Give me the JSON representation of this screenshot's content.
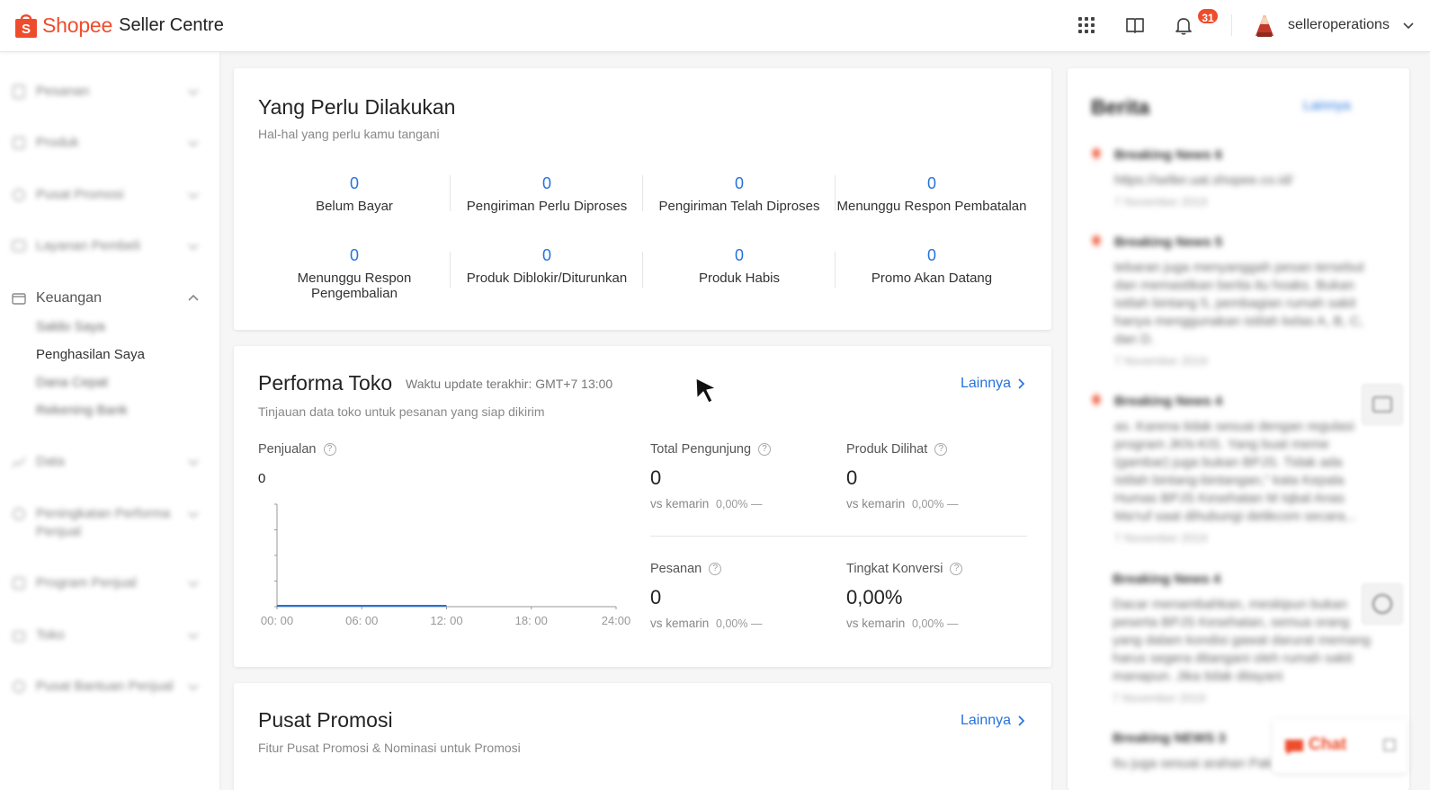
{
  "header": {
    "brand": "Shopee",
    "product": "Seller Centre",
    "notification_count": "31",
    "username": "selleroperations",
    "brand_color": "#ee4d2d",
    "icons": [
      "apps-grid-icon",
      "book-icon",
      "bell-icon",
      "avatar",
      "chevron-down-icon"
    ]
  },
  "sidebar": {
    "items": [
      {
        "label": "Pesanan",
        "icon": "clipboard-icon"
      },
      {
        "label": "Produk",
        "icon": "box-icon"
      },
      {
        "label": "Pusat Promosi",
        "icon": "tag-icon"
      },
      {
        "label": "Layanan Pembeli",
        "icon": "chat-icon"
      },
      {
        "label": "Keuangan",
        "icon": "wallet-icon"
      },
      {
        "label": "Data",
        "icon": "chart-icon"
      },
      {
        "label": "Peningkatan Performa Penjual",
        "icon": "trophy-icon"
      },
      {
        "label": "Program Penjual",
        "icon": "star-icon"
      },
      {
        "label": "Toko",
        "icon": "shop-icon"
      },
      {
        "label": "Pusat Bantuan Penjual",
        "icon": "help-icon"
      }
    ],
    "keuangan_sub": [
      "Saldo Saya",
      "Penghasilan Saya",
      "Dana Cepat",
      "Rekening Bank"
    ]
  },
  "todo": {
    "title": "Yang Perlu Dilakukan",
    "subtitle": "Hal-hal yang perlu kamu tangani",
    "items": [
      {
        "value": "0",
        "label": "Belum Bayar"
      },
      {
        "value": "0",
        "label": "Pengiriman Perlu Diproses"
      },
      {
        "value": "0",
        "label": "Pengiriman Telah Diproses"
      },
      {
        "value": "0",
        "label": "Menunggu Respon Pembatalan"
      },
      {
        "value": "0",
        "label": "Menunggu Respon Pengembalian"
      },
      {
        "value": "0",
        "label": "Produk Diblokir/Diturunkan"
      },
      {
        "value": "0",
        "label": "Produk Habis"
      },
      {
        "value": "0",
        "label": "Promo Akan Datang"
      }
    ]
  },
  "performa": {
    "title": "Performa Toko",
    "update_time": "Waktu update terakhir: GMT+7 13:00",
    "subtitle": "Tinjauan data toko untuk pesanan yang siap dikirim",
    "more": "Lainnya",
    "sales_label": "Penjualan",
    "sales_value": "0",
    "metrics": [
      {
        "label": "Total Pengunjung",
        "value": "0",
        "vs_label": "vs kemarin",
        "vs_value": "0,00% —"
      },
      {
        "label": "Produk Dilihat",
        "value": "0",
        "vs_label": "vs kemarin",
        "vs_value": "0,00% —"
      },
      {
        "label": "Pesanan",
        "value": "0",
        "vs_label": "vs kemarin",
        "vs_value": "0,00% —"
      },
      {
        "label": "Tingkat Konversi",
        "value": "0,00%",
        "vs_label": "vs kemarin",
        "vs_value": "0,00% —"
      }
    ]
  },
  "chart_data": {
    "type": "line",
    "x": [
      "00: 00",
      "06: 00",
      "12: 00",
      "18: 00",
      "24:00"
    ],
    "series": [
      {
        "values": [
          0,
          0,
          0
        ]
      }
    ],
    "title": "",
    "xlabel": "",
    "ylabel": "",
    "line_color": "#2673dd"
  },
  "promosi": {
    "title": "Pusat Promosi",
    "subtitle": "Fitur Pusat Promosi  & Nominasi untuk Promosi",
    "more": "Lainnya"
  },
  "news": {
    "title": "Berita",
    "more": "Lainnya",
    "items": [
      {
        "title": "Breaking News 6",
        "body": "https://seller.uat.shopee.co.id/",
        "date": "7 November 2019"
      },
      {
        "title": "Breaking News 5",
        "body": "tebaran juga menyanggah pesan tersebut dan memastikan berita itu hoaks. Bukan istilah bintang 5, pembagian rumah sakit hanya menggunakan istilah kelas A, B, C, dan D.",
        "date": "7 November 2019"
      },
      {
        "title": "Breaking News 4",
        "body": "as. Karena tidak sesuai dengan regulasi program JKN-KIS. Yang buat meme (gambar) juga bukan BPJS. Tidak ada istilah bintang-bintangan,\" kata Kepala Humas BPJS Kesehatan M Iqbal Anas Ma'ruf saat dihubungi detikcom secara...",
        "date": "7 November 2019"
      },
      {
        "title": "Breaking News 4",
        "body": "Dacar menambahkan, meskipun bukan peserta BPJS Kesehatan, semua orang yang dalam kondisi gawat darurat memang harus segera ditangani oleh rumah sakit manapun. Jika tidak ditayani",
        "date": "7 November 2019"
      },
      {
        "title": "Breaking NEWS 3",
        "body": " Itu juga sesuai arahan Pak",
        "date": ""
      }
    ]
  },
  "chat": {
    "label": "Chat"
  }
}
